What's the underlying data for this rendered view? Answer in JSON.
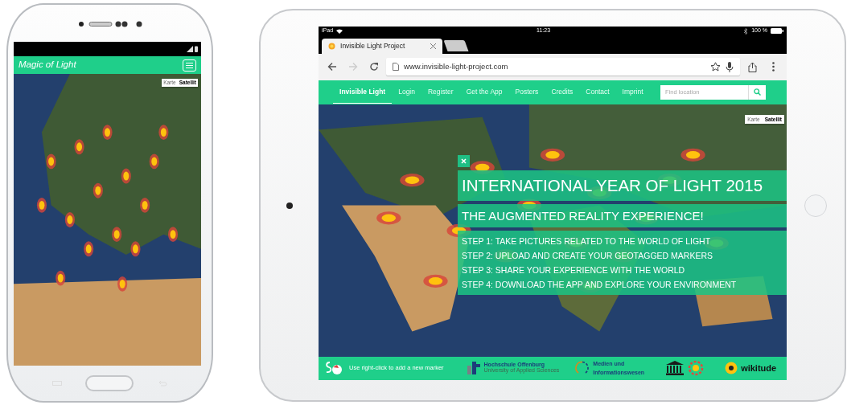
{
  "phone": {
    "app_bar": {
      "title": "Magic of Light"
    },
    "map_type_toggle": [
      {
        "label": "Karte",
        "selected": false
      },
      {
        "label": "Satellit",
        "selected": true
      }
    ]
  },
  "tablet": {
    "status_bar": {
      "carrier": "iPad",
      "time": "11:23",
      "battery": "100 %"
    },
    "browser": {
      "tabs": [
        {
          "label": "Invisible Light Project",
          "selected": true
        },
        {
          "selected": false
        }
      ],
      "forward_disabled": true,
      "address": "www.invisible-light-project.com"
    },
    "nav": {
      "items": [
        {
          "label": "Invisible Light",
          "selected": true
        },
        {
          "label": "Login",
          "selected": false
        },
        {
          "label": "Register",
          "selected": false
        },
        {
          "label": "Get the App",
          "selected": false
        },
        {
          "label": "Posters",
          "selected": false
        },
        {
          "label": "Credits",
          "selected": false
        },
        {
          "label": "Contact",
          "selected": false
        },
        {
          "label": "Imprint",
          "selected": false
        }
      ],
      "search": {
        "placeholder": "Find location"
      }
    },
    "map_type_toggle": [
      {
        "label": "Karte",
        "selected": false
      },
      {
        "label": "Satellit",
        "selected": true
      }
    ],
    "banner": {
      "title": "INTERNATIONAL YEAR OF LIGHT 2015",
      "subtitle": "THE AUGMENTED REALITY EXPERIENCE!",
      "steps": [
        "STEP 1: TAKE PICTURES RELATED TO THE WORLD OF LIGHT",
        "STEP 2: UPLOAD AND CREATE YOUR GEOTAGGED MARKERS",
        "STEP 3: SHARE YOUR EXPERIENCE WITH THE WORLD",
        "STEP 4: DOWNLOAD THE APP AND EXPLORE YOUR ENVIRONMENT"
      ]
    },
    "footer": {
      "hint": "Use right-click to add a new marker",
      "logos": [
        {
          "kind": "university",
          "name": "Hochschule Offenburg",
          "tagline": "University of Applied Sciences"
        },
        {
          "kind": "faculty",
          "name": "Medien und",
          "tagline": "Informationswesen"
        },
        {
          "kind": "unesco"
        },
        {
          "kind": "wikitude",
          "name": "wikitude"
        }
      ]
    }
  }
}
